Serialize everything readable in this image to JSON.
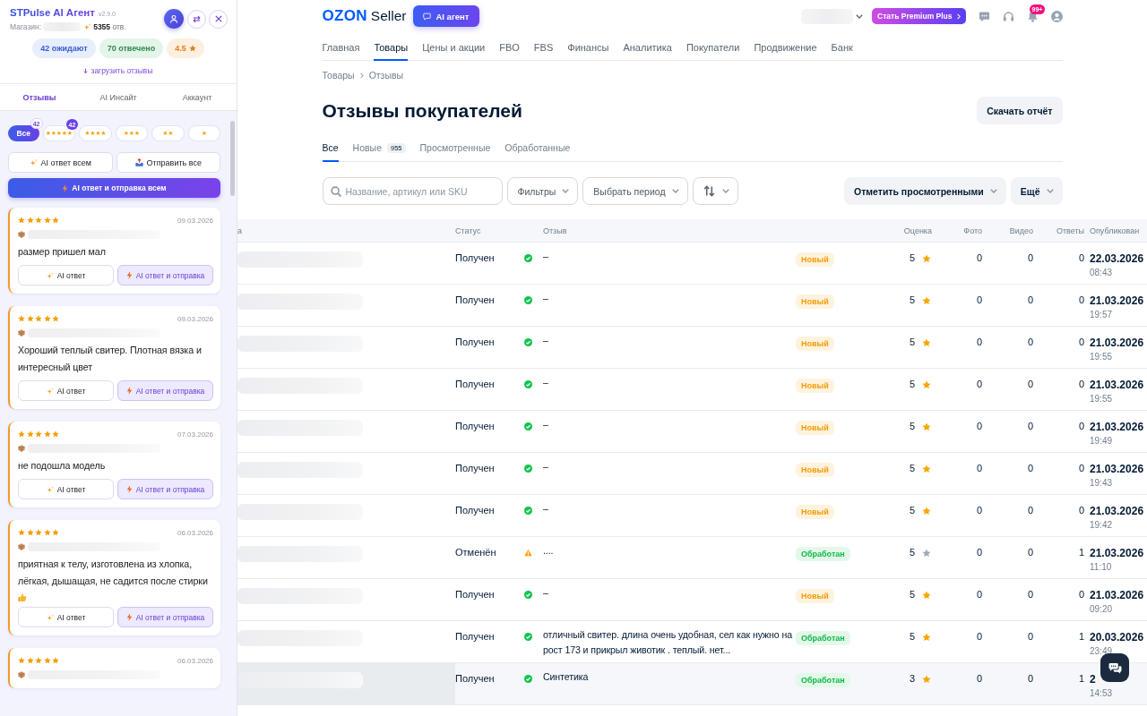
{
  "extension_panel": {
    "title": "STPulse AI Агент",
    "version": "v2.9.0",
    "store_label": "Магазин:",
    "answers_count": "**5355** отв.",
    "stats": [
      {
        "text": "42 ожидают",
        "kind": "waiting"
      },
      {
        "text": "70 отвечено",
        "kind": "answered"
      },
      {
        "text": "4.5",
        "kind": "rating"
      }
    ],
    "load_link": "загрузить отзывы",
    "tabs": [
      {
        "label": "Отзывы",
        "selected": true
      },
      {
        "label": "AI Инсайт",
        "selected": false
      },
      {
        "label": "Аккаунт",
        "selected": false
      }
    ],
    "star_filters": [
      {
        "kind": "all",
        "label": "Все",
        "badge": "42",
        "selected": true
      },
      {
        "kind": "stars",
        "label": "★★★★★",
        "badge": "42",
        "selected": false
      },
      {
        "kind": "stars",
        "label": "★★★★",
        "selected": false
      },
      {
        "kind": "stars",
        "label": "★★★",
        "selected": false
      },
      {
        "kind": "stars",
        "label": "★★",
        "selected": false
      },
      {
        "kind": "stars",
        "label": "★",
        "selected": false
      }
    ],
    "bulk_actions": [
      {
        "label": "AI ответ всем",
        "kind": "ai"
      },
      {
        "label": "Отправить все",
        "kind": "send"
      }
    ],
    "primary_action": "AI ответ и отправка всем",
    "reviews": [
      {
        "stars": 5,
        "date": "09.03.2026",
        "text": "размер пришел мал",
        "thumbs_up": false,
        "actions": [
          {
            "label": "AI ответ",
            "kind": "ai"
          },
          {
            "label": "AI ответ и отправка",
            "kind": "send"
          }
        ]
      },
      {
        "stars": 5,
        "date": "09.03.2026",
        "text": "Хороший теплый свитер. Плотная вязка и интересный цвет",
        "thumbs_up": false,
        "actions": [
          {
            "label": "AI ответ",
            "kind": "ai"
          },
          {
            "label": "AI ответ и отправка",
            "kind": "send"
          }
        ]
      },
      {
        "stars": 5,
        "date": "07.03.2026",
        "text": "не подошла модель",
        "thumbs_up": false,
        "actions": [
          {
            "label": "AI ответ",
            "kind": "ai"
          },
          {
            "label": "AI ответ и отправка",
            "kind": "send"
          }
        ]
      },
      {
        "stars": 5,
        "date": "06.03.2026",
        "text": "приятная к телу, изготовлена из хлопка, лёгкая, дышащая, не садится после стирки",
        "thumbs_up": true,
        "actions": [
          {
            "label": "AI ответ",
            "kind": "ai"
          },
          {
            "label": "AI ответ и отправка",
            "kind": "send"
          }
        ]
      },
      {
        "stars": 5,
        "date": "06.03.2026",
        "thumbs_up": false
      }
    ]
  },
  "header": {
    "logo": "OZON",
    "logo_suffix": "Seller",
    "ai_button": "AI агент",
    "premium_button": "Стать Premium Plus",
    "notifications_badge": "99+"
  },
  "nav": [
    {
      "label": "Главная",
      "selected": false
    },
    {
      "label": "Товары",
      "selected": true
    },
    {
      "label": "Цены и акции",
      "selected": false
    },
    {
      "label": "FBO",
      "selected": false
    },
    {
      "label": "FBS",
      "selected": false
    },
    {
      "label": "Финансы",
      "selected": false
    },
    {
      "label": "Аналитика",
      "selected": false
    },
    {
      "label": "Покупатели",
      "selected": false
    },
    {
      "label": "Продвижение",
      "selected": false
    },
    {
      "label": "Банк",
      "selected": false
    }
  ],
  "breadcrumbs": [
    "Товары",
    "Отзывы"
  ],
  "page_title": "Отзывы покупателей",
  "download_button": "Скачать отчёт",
  "tabs": [
    {
      "label": "Все",
      "selected": true
    },
    {
      "label": "Новые",
      "count": "955",
      "selected": false
    },
    {
      "label": "Просмотренные",
      "selected": false
    },
    {
      "label": "Обработанные",
      "selected": false
    }
  ],
  "filters": {
    "search": {
      "placeholder": "Название, артикул или SKU"
    },
    "dropdowns": [
      "Фильтры",
      "Выбрать период"
    ],
    "actions": [
      "Отметить просмотренными",
      "Ещё"
    ]
  },
  "table": {
    "columns": [
      "а",
      "Статус",
      "Отзыв",
      "Оценка",
      "Фото",
      "Видео",
      "Ответы",
      "Опубликован"
    ],
    "rows": [
      {
        "status": {
          "text": "Получен",
          "kind": "ok"
        },
        "review": "–",
        "badge": {
          "text": "Новый",
          "kind": "new"
        },
        "rating": "5",
        "star_active": true,
        "photos": "0",
        "videos": "0",
        "answers": "0",
        "date": "22.03.2026",
        "time": "08:43",
        "highlighted": false
      },
      {
        "status": {
          "text": "Получен",
          "kind": "ok"
        },
        "review": "–",
        "badge": {
          "text": "Новый",
          "kind": "new"
        },
        "rating": "5",
        "star_active": true,
        "photos": "0",
        "videos": "0",
        "answers": "0",
        "date": "21.03.2026",
        "time": "19:57",
        "highlighted": false
      },
      {
        "status": {
          "text": "Получен",
          "kind": "ok"
        },
        "review": "–",
        "badge": {
          "text": "Новый",
          "kind": "new"
        },
        "rating": "5",
        "star_active": true,
        "photos": "0",
        "videos": "0",
        "answers": "0",
        "date": "21.03.2026",
        "time": "19:55",
        "highlighted": false
      },
      {
        "status": {
          "text": "Получен",
          "kind": "ok"
        },
        "review": "–",
        "badge": {
          "text": "Новый",
          "kind": "new"
        },
        "rating": "5",
        "star_active": true,
        "photos": "0",
        "videos": "0",
        "answers": "0",
        "date": "21.03.2026",
        "time": "19:55",
        "highlighted": false
      },
      {
        "status": {
          "text": "Получен",
          "kind": "ok"
        },
        "review": "–",
        "badge": {
          "text": "Новый",
          "kind": "new"
        },
        "rating": "5",
        "star_active": true,
        "photos": "0",
        "videos": "0",
        "answers": "0",
        "date": "21.03.2026",
        "time": "19:49",
        "highlighted": false
      },
      {
        "status": {
          "text": "Получен",
          "kind": "ok"
        },
        "review": "–",
        "badge": {
          "text": "Новый",
          "kind": "new"
        },
        "rating": "5",
        "star_active": true,
        "photos": "0",
        "videos": "0",
        "answers": "0",
        "date": "21.03.2026",
        "time": "19:43",
        "highlighted": false
      },
      {
        "status": {
          "text": "Получен",
          "kind": "ok"
        },
        "review": "–",
        "badge": {
          "text": "Новый",
          "kind": "new"
        },
        "rating": "5",
        "star_active": true,
        "photos": "0",
        "videos": "0",
        "answers": "0",
        "date": "21.03.2026",
        "time": "19:42",
        "highlighted": false
      },
      {
        "status": {
          "text": "Отменён",
          "kind": "warning"
        },
        "review": "....",
        "badge": {
          "text": "Обработан",
          "kind": "processed"
        },
        "rating": "5",
        "star_active": false,
        "photos": "0",
        "videos": "0",
        "answers": "1",
        "date": "21.03.2026",
        "time": "11:10",
        "highlighted": false
      },
      {
        "status": {
          "text": "Получен",
          "kind": "ok"
        },
        "review": "–",
        "badge": {
          "text": "Новый",
          "kind": "new"
        },
        "rating": "5",
        "star_active": true,
        "photos": "0",
        "videos": "0",
        "answers": "0",
        "date": "21.03.2026",
        "time": "09:20",
        "highlighted": false
      },
      {
        "status": {
          "text": "Получен",
          "kind": "ok"
        },
        "review": "отличный свитер. длина очень удобная, сел как нужно на рост 173 и прикрыл животик . теплый. нет...",
        "badge": {
          "text": "Обработан",
          "kind": "processed"
        },
        "rating": "5",
        "star_active": true,
        "photos": "0",
        "videos": "0",
        "answers": "1",
        "date": "20.03.2026",
        "time": "23:49",
        "highlighted": false
      },
      {
        "status": {
          "text": "Получен",
          "kind": "ok"
        },
        "review": "Синтетика",
        "badge": {
          "text": "Обработан",
          "kind": "processed"
        },
        "rating": "3",
        "star_active": true,
        "photos": "0",
        "videos": "0",
        "answers": "1",
        "date": "2",
        "time": "14:53",
        "highlighted": true
      }
    ]
  }
}
